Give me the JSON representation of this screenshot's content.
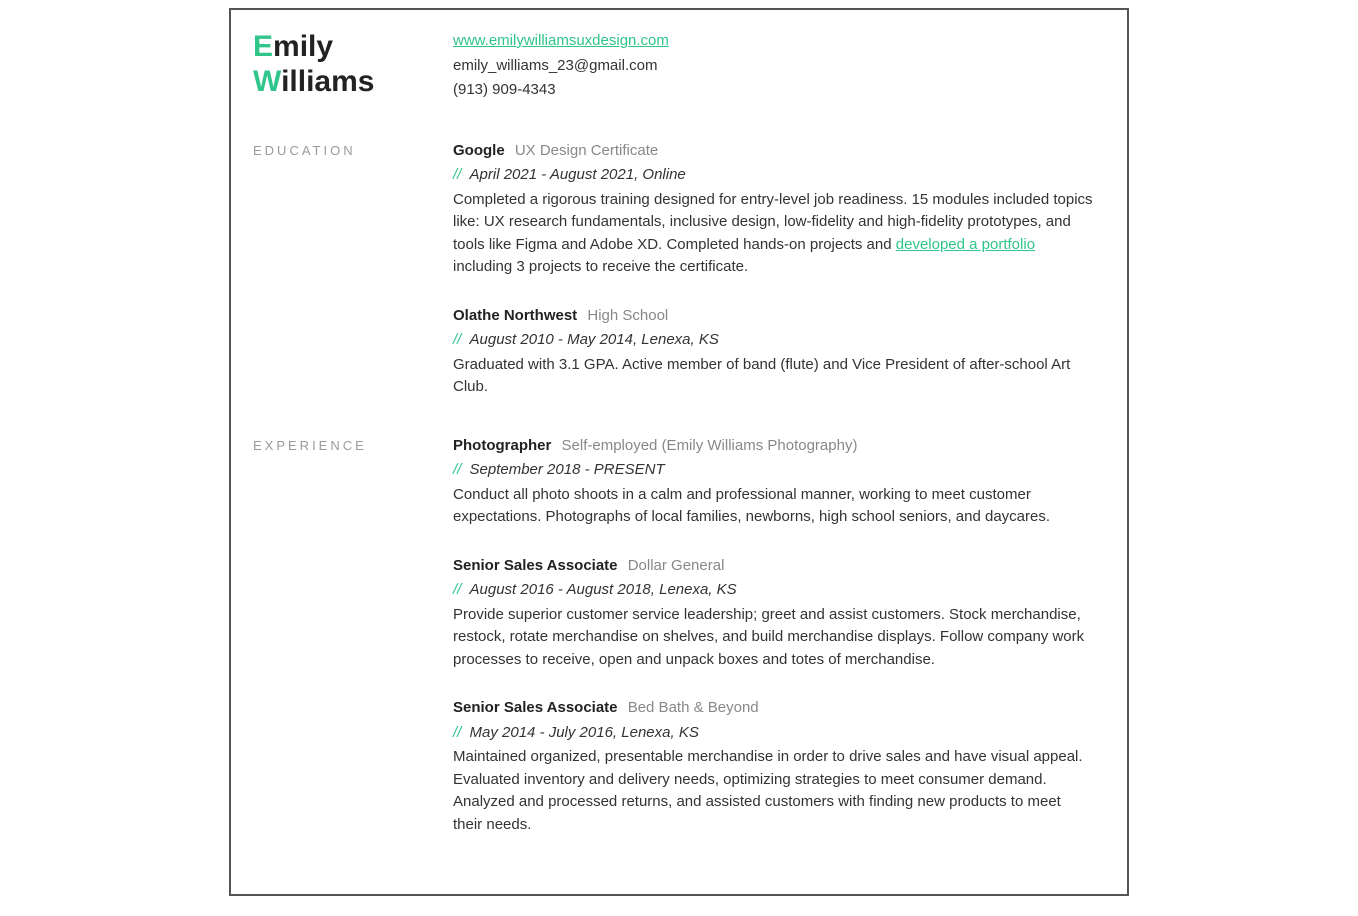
{
  "header": {
    "firstName": "Emily",
    "lastName": "Williams",
    "website": "www.emilywilliamsuxdesign.com",
    "email": "emily_williams_23@gmail.com",
    "phone": "(913) 909-4343"
  },
  "sections": {
    "educationLabel": "EDUCATION",
    "experienceLabel": "EXPERIENCE"
  },
  "slashes": "//",
  "education": [
    {
      "title": "Google",
      "subtitle": "UX Design Certificate",
      "date": "April 2021 - August 2021, Online",
      "desc_before_link": "Completed a rigorous training designed for entry-level job readiness. 15 modules included topics like: UX research fundamentals, inclusive design, low-fidelity and high-fidelity prototypes, and tools like Figma and Adobe XD. Completed hands-on projects and ",
      "link_text": "developed a portfolio",
      "desc_after_link": " including 3 projects to receive the certificate."
    },
    {
      "title": "Olathe Northwest",
      "subtitle": "High School",
      "date": "August 2010 - May 2014, Lenexa, KS",
      "desc": "Graduated with 3.1 GPA. Active member of band (flute) and Vice President of after-school Art Club."
    }
  ],
  "experience": [
    {
      "title": "Photographer",
      "subtitle": "Self-employed (Emily Williams Photography)",
      "date": "September 2018 - PRESENT",
      "desc": "Conduct all photo shoots in a calm and professional manner, working to meet customer expectations. Photographs of local families, newborns, high school seniors, and daycares."
    },
    {
      "title": "Senior Sales Associate",
      "subtitle": "Dollar General",
      "date": "August 2016 - August 2018, Lenexa, KS",
      "desc": "Provide superior customer service leadership; greet and assist customers. Stock merchandise, restock, rotate merchandise on shelves, and build merchandise displays. Follow company work processes to receive, open and unpack boxes and totes of merchandise."
    },
    {
      "title": "Senior Sales Associate",
      "subtitle": "Bed Bath & Beyond",
      "date": "May 2014 - July 2016, Lenexa, KS",
      "desc": "Maintained organized, presentable merchandise in order to drive sales and have visual appeal. Evaluated inventory and delivery needs, optimizing strategies to meet consumer demand. Analyzed and processed returns, and assisted customers with finding new products to meet their needs."
    }
  ]
}
